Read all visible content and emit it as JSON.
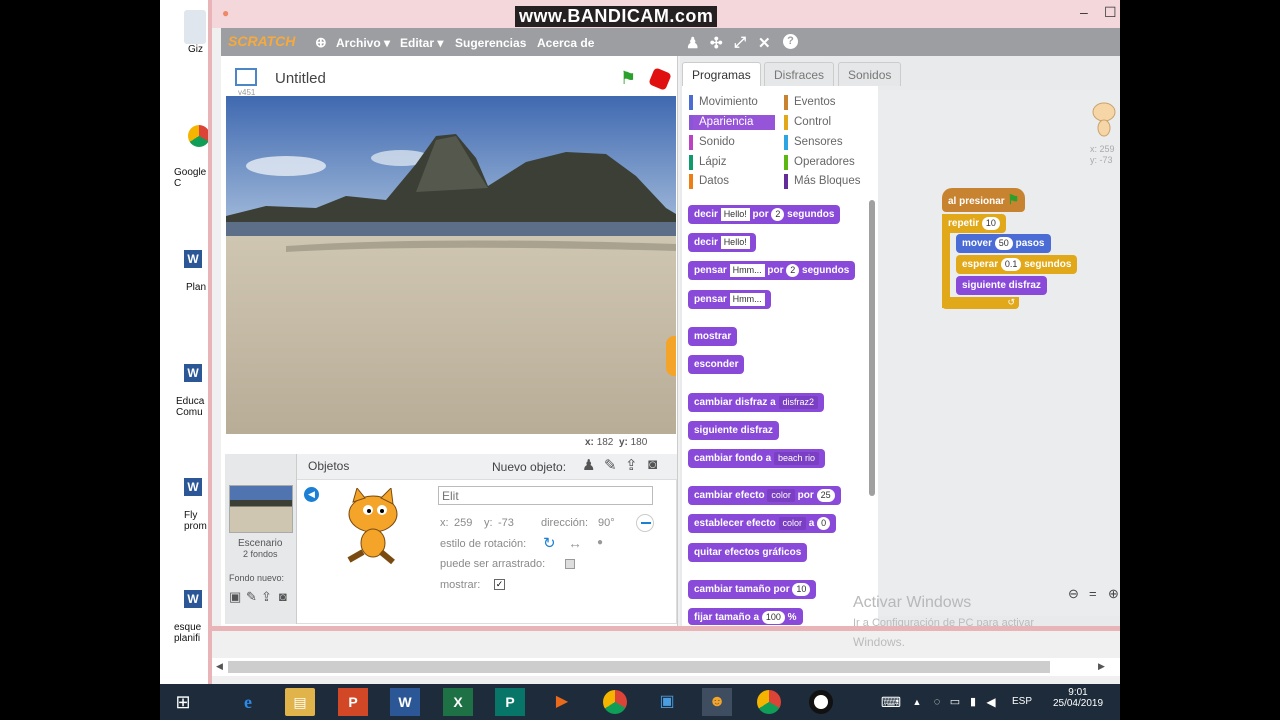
{
  "window": {
    "watermark": "www.BANDICAM.com"
  },
  "menu": {
    "logo": "SCRATCH",
    "items": [
      "Archivo ▾",
      "Editar ▾",
      "Sugerencias",
      "Acerca de"
    ]
  },
  "stage": {
    "version": "v451",
    "title": "Untitled",
    "coords_x_label": "x:",
    "coords_x": "182",
    "coords_y_label": "y:",
    "coords_y": "180"
  },
  "sprites": {
    "header": "Objetos",
    "new_object": "Nuevo objeto:",
    "stage_label": "Escenario",
    "stage_backdrops": "2 fondos",
    "new_backdrop": "Fondo nuevo:",
    "name_placeholder": "Elit",
    "x_label": "x:",
    "x": "259",
    "y_label": "y:",
    "y": "-73",
    "direction_label": "dirección:",
    "direction": "90°",
    "rotation_label": "estilo de rotación:",
    "draggable_label": "puede ser arrastrado:",
    "show_label": "mostrar:"
  },
  "tabs": [
    "Programas",
    "Disfraces",
    "Sonidos"
  ],
  "categories": {
    "left": [
      {
        "label": "Movimiento",
        "color": "#4a6cd4"
      },
      {
        "label": "Apariencia",
        "color": "#8a55d7"
      },
      {
        "label": "Sonido",
        "color": "#bb42c3"
      },
      {
        "label": "Lápiz",
        "color": "#0e9a6c"
      },
      {
        "label": "Datos",
        "color": "#ee7d16"
      }
    ],
    "right": [
      {
        "label": "Eventos",
        "color": "#c88330"
      },
      {
        "label": "Control",
        "color": "#e1a91a"
      },
      {
        "label": "Sensores",
        "color": "#2ca5e2"
      },
      {
        "label": "Operadores",
        "color": "#5cb712"
      },
      {
        "label": "Más Bloques",
        "color": "#632d99"
      }
    ]
  },
  "blocks": {
    "say_secs": [
      "decir",
      "Hello!",
      "por",
      "2",
      "segundos"
    ],
    "say": [
      "decir",
      "Hello!"
    ],
    "think_secs": [
      "pensar",
      "Hmm...",
      "por",
      "2",
      "segundos"
    ],
    "think": [
      "pensar",
      "Hmm..."
    ],
    "show": "mostrar",
    "hide": "esconder",
    "switch_costume": [
      "cambiar disfraz a",
      "disfraz2"
    ],
    "next_costume": "siguiente disfraz",
    "switch_backdrop": [
      "cambiar fondo a",
      "beach rio"
    ],
    "change_effect": [
      "cambiar efecto",
      "color",
      "por",
      "25"
    ],
    "set_effect": [
      "establecer efecto",
      "color",
      "a",
      "0"
    ],
    "clear_effects": "quitar efectos gráficos",
    "change_size": [
      "cambiar tamaño por",
      "10"
    ],
    "set_size_partial": [
      "fijar tamaño a",
      "100",
      "%"
    ]
  },
  "script": {
    "hat": "al presionar",
    "repeat": [
      "repetir",
      "10"
    ],
    "move": [
      "mover",
      "50",
      "pasos"
    ],
    "wait": [
      "esperar",
      "0.1",
      "segundos"
    ],
    "next": "siguiente disfraz",
    "sprite_x": "x: 259",
    "sprite_y": "y: -73"
  },
  "watermark_windows": {
    "line1": "Activar Windows",
    "line2": "Ir a Configuración de PC para activar",
    "line3": "Windows."
  },
  "desktop_icons": [
    "Giz",
    "Google C",
    "Plan",
    "Educa Comu",
    "Fly prom",
    "esque planifi"
  ],
  "tray": {
    "lang": "ESP",
    "time": "9:01",
    "date": "25/04/2019"
  }
}
